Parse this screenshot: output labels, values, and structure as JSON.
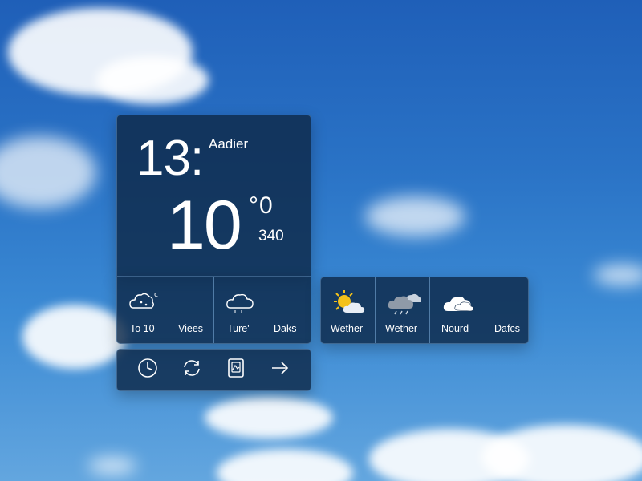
{
  "clock": {
    "time": "13:",
    "location": "Aadier",
    "temperature": "10",
    "degree_mark": "°0",
    "secondary_value": "340"
  },
  "left_tiles": [
    {
      "icon": "cloudy-cold-icon",
      "label": "To 10"
    },
    {
      "icon": "",
      "label": "Viees"
    },
    {
      "icon": "cloud-icon",
      "label": "Ture'"
    },
    {
      "icon": "",
      "label": "Daks"
    }
  ],
  "right_tiles": [
    {
      "icon": "sun-cloud-icon",
      "label": "Wether"
    },
    {
      "icon": "rain-cloud-icon",
      "label": "Wether"
    },
    {
      "icon": "white-cloud-icon",
      "label": "Nourd"
    },
    {
      "icon": "",
      "label": "Dafcs"
    }
  ],
  "actions": [
    {
      "icon": "clock-icon"
    },
    {
      "icon": "refresh-icon"
    },
    {
      "icon": "document-icon"
    },
    {
      "icon": "arrow-right-icon"
    }
  ],
  "colors": {
    "panel": "#0e2848",
    "sky_top": "#1f5fb8",
    "sky_bottom": "#63a6df",
    "sun": "#f4c21a"
  }
}
